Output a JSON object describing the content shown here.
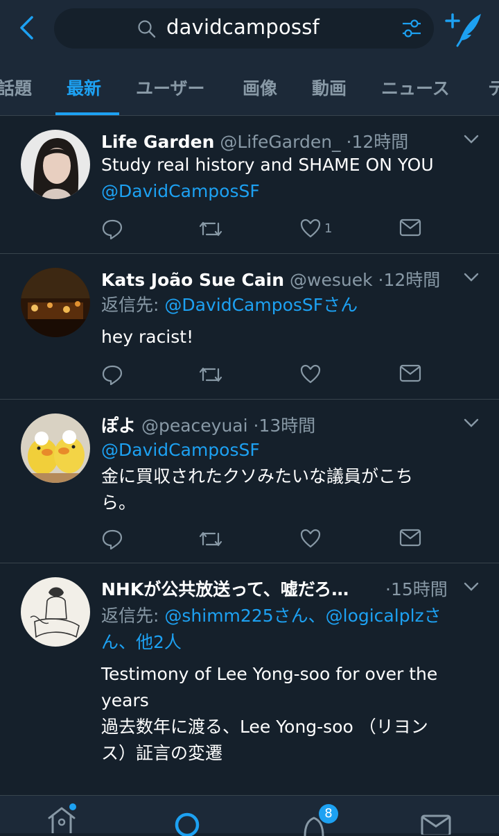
{
  "search": {
    "query": "davidcampossf"
  },
  "tabs": [
    {
      "label": "話題"
    },
    {
      "label": "最新"
    },
    {
      "label": "ユーザー"
    },
    {
      "label": "画像"
    },
    {
      "label": "動画"
    },
    {
      "label": "ニュース"
    },
    {
      "label": "テ"
    }
  ],
  "active_tab": "最新",
  "tweets": [
    {
      "name": "Life Garden",
      "handle": "@LifeGarden_",
      "time": "12時間",
      "text": "Study real history and SHAME ON YOU",
      "mention": "@DavidCamposSF",
      "like_count": "1"
    },
    {
      "name": "Kats João Sue Cain",
      "handle": "@wesuek",
      "time": "12時間",
      "reply_label": "返信先:",
      "reply_to": "@DavidCamposSFさん",
      "text": "hey racist!"
    },
    {
      "name": "ぽよ",
      "handle": "@peaceyuai",
      "time": "13時間",
      "mention": "@DavidCamposSF",
      "text_line1": "金に買収されたクソみたいな議員がこち",
      "text_line2": "ら。"
    },
    {
      "name": "NHKが公共放送って、嘘だろ…",
      "time": "15時間",
      "reply_label": "返信先:",
      "reply_to_line1": "@shimm225さん、@logicalplzさ",
      "reply_to_line2": "ん、他2人",
      "text_line1": "Testimony of Lee Yong-soo for over the",
      "text_line2": "years",
      "text_line3": "過去数年に渡る、Lee Yong-soo （リヨン",
      "text_line4": "ス）証言の変遷"
    }
  ],
  "dot_sep": "·",
  "bottom_nav": {
    "notification_badge": "8"
  },
  "colors": {
    "accent": "#1da1f2",
    "background": "#15202b",
    "bar": "#1c2938",
    "muted": "#8899a6"
  }
}
